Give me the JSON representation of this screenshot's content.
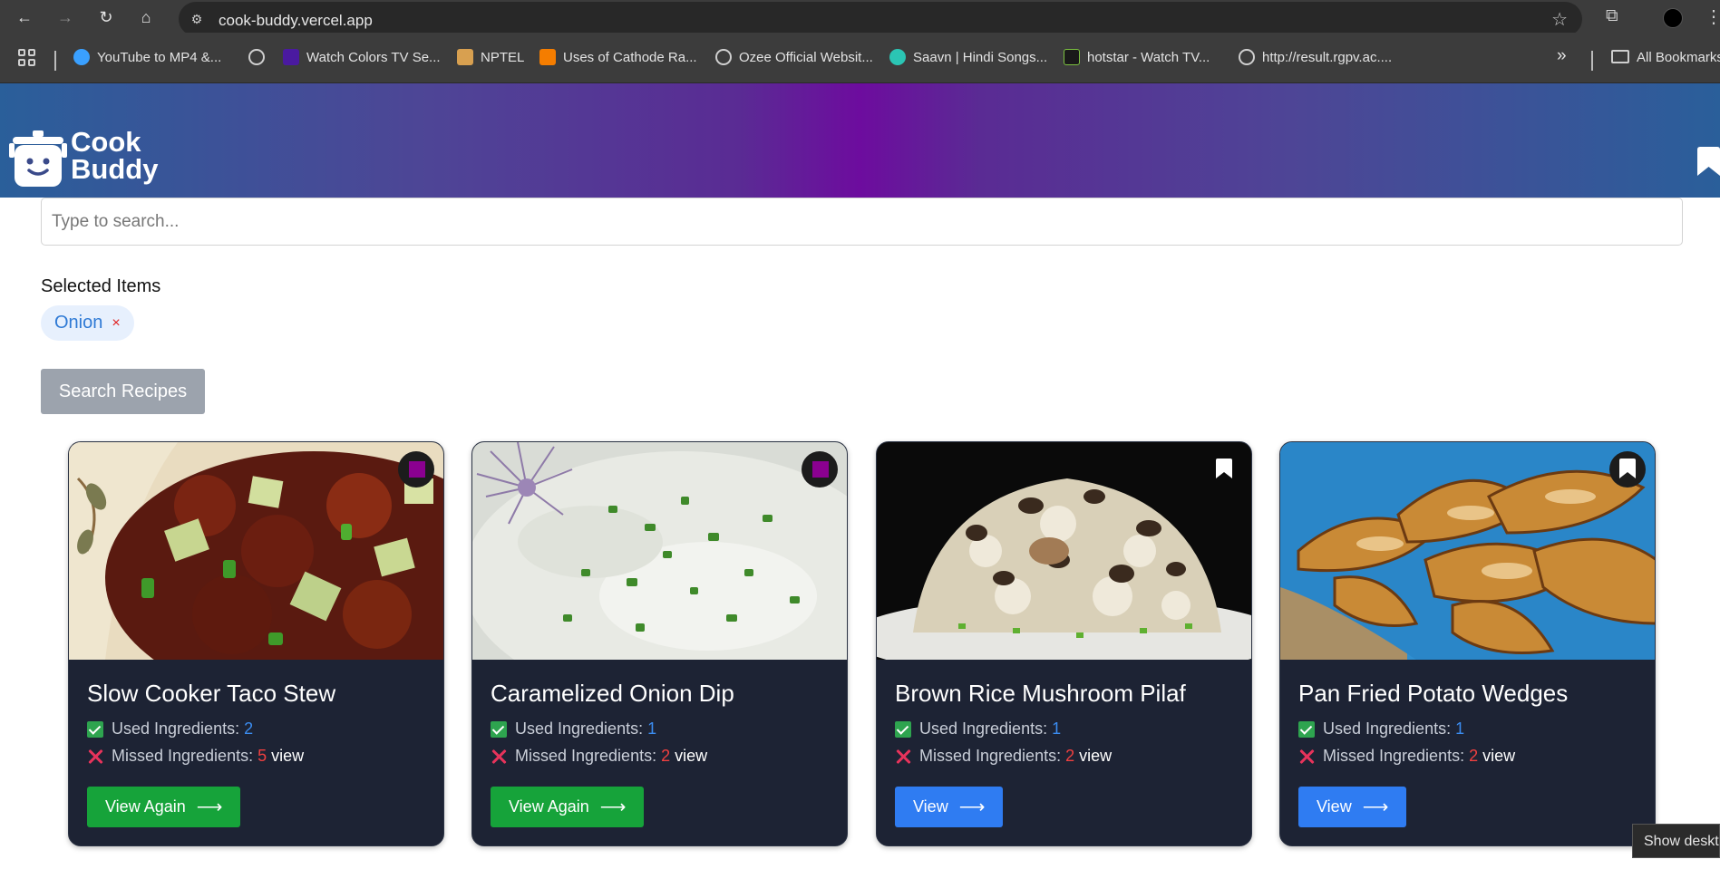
{
  "browser": {
    "url": "cook-buddy.vercel.app",
    "bookmarks": [
      {
        "label": "YouTube to MP4 &...",
        "icon": "youtube-converter-icon",
        "color": "#3aa0ff"
      },
      {
        "label": "",
        "icon": "globe-icon",
        "color": "#cfcfcf"
      },
      {
        "label": "Watch Colors TV Se...",
        "icon": "voot-icon",
        "color": "#4a1aa0"
      },
      {
        "label": "NPTEL",
        "icon": "nptel-icon",
        "color": "#d8a050"
      },
      {
        "label": "Uses of Cathode Ra...",
        "icon": "blogger-icon",
        "color": "#f57d00"
      },
      {
        "label": "Ozee Official Websit...",
        "icon": "globe-icon",
        "color": "#cfcfcf"
      },
      {
        "label": "Saavn | Hindi Songs...",
        "icon": "saavn-icon",
        "color": "#2bc5b4"
      },
      {
        "label": "hotstar - Watch TV...",
        "icon": "hotstar-icon",
        "color": "#1a1a1a"
      },
      {
        "label": "http://result.rgpv.ac....",
        "icon": "globe-icon",
        "color": "#cfcfcf"
      }
    ],
    "all_bookmarks_label": "All Bookmarks"
  },
  "header": {
    "logo_line1": "Cook",
    "logo_line2": "Buddy"
  },
  "search": {
    "placeholder": "Type to search...",
    "value": ""
  },
  "selected": {
    "label": "Selected Items",
    "items": [
      {
        "label": "Onion",
        "remove": "×"
      }
    ]
  },
  "search_button_label": "Search Recipes",
  "cards": [
    {
      "title": "Slow Cooker Taco Stew",
      "used_label": "Used Ingredients:",
      "used_count": "2",
      "missed_label": "Missed Ingredients:",
      "missed_count": "5",
      "view_link": "view",
      "button_label": "View Again",
      "button_color": "#16a33a",
      "saved": true,
      "image": "taco-stew-photo"
    },
    {
      "title": "Caramelized Onion Dip",
      "used_label": "Used Ingredients:",
      "used_count": "1",
      "missed_label": "Missed Ingredients:",
      "missed_count": "2",
      "view_link": "view",
      "button_label": "View Again",
      "button_color": "#16a33a",
      "saved": true,
      "image": "onion-dip-photo"
    },
    {
      "title": "Brown Rice Mushroom Pilaf",
      "used_label": "Used Ingredients:",
      "used_count": "1",
      "missed_label": "Missed Ingredients:",
      "missed_count": "2",
      "view_link": "view",
      "button_label": "View",
      "button_color": "#2f7cf2",
      "saved": false,
      "image": "mushroom-pilaf-photo"
    },
    {
      "title": "Pan Fried Potato Wedges",
      "used_label": "Used Ingredients:",
      "used_count": "1",
      "missed_label": "Missed Ingredients:",
      "missed_count": "2",
      "view_link": "view",
      "button_label": "View",
      "button_color": "#2f7cf2",
      "saved": false,
      "image": "potato-wedges-photo"
    }
  ],
  "tooltip": "Show desktop"
}
